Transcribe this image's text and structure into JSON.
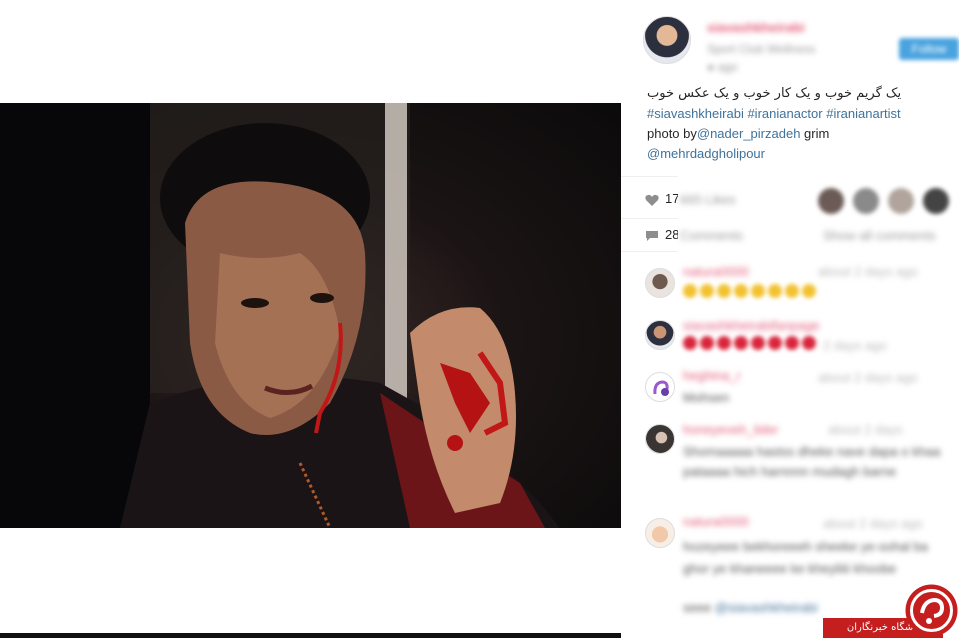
{
  "post": {
    "caption_persian": "یک گریم خوب و یک کار خوب و یک عکس خوب",
    "hashtags": "#siavashkheirabi #iranianactor #iranianartist",
    "photo_by_prefix": "photo by",
    "photo_by_handle": "@nader_pirzadeh",
    "grim_label": " grim",
    "grim_handle": "@mehrdadgholipour"
  },
  "stats": {
    "likes": "17",
    "comments": "28"
  },
  "watermark": {
    "label": "باشگاه خبرنگاران"
  },
  "colors": {
    "hashtag": "#3f729b",
    "username_pink": "#e35d7a",
    "follow_blue": "#4aa3df",
    "watermark_red": "#c41e1e"
  }
}
